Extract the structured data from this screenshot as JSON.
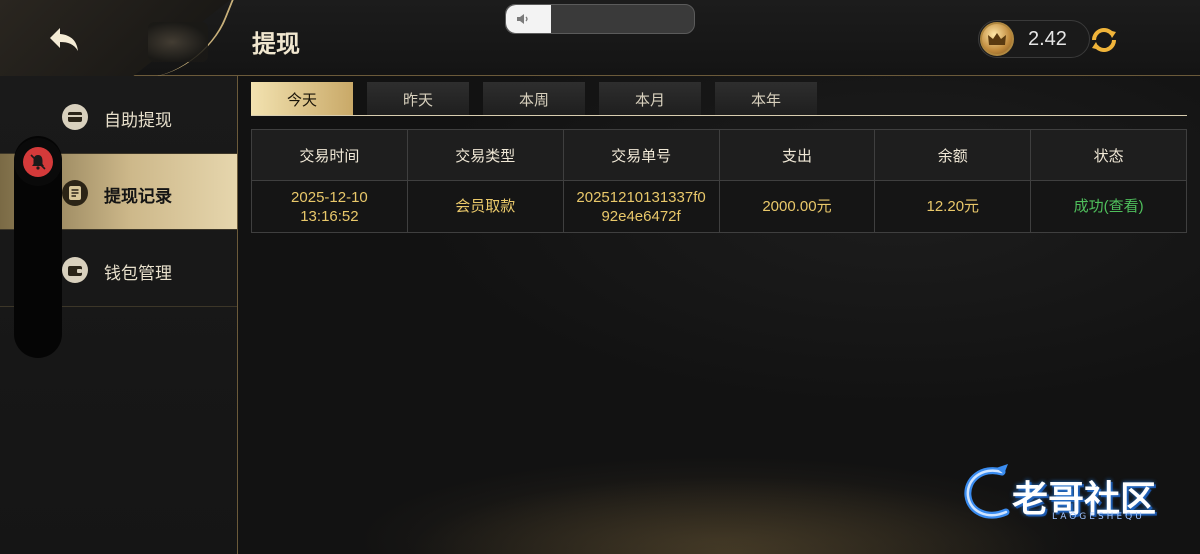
{
  "header": {
    "title": "提现",
    "volume_level": 0.24,
    "balance": "2.42"
  },
  "sidebar": {
    "items": [
      {
        "label": "自助提现",
        "icon": "card-icon",
        "active": false
      },
      {
        "label": "提现记录",
        "icon": "record-icon",
        "active": true
      },
      {
        "label": "钱包管理",
        "icon": "wallet-icon",
        "active": false
      }
    ]
  },
  "tabs": [
    {
      "label": "今天",
      "active": true
    },
    {
      "label": "昨天",
      "active": false
    },
    {
      "label": "本周",
      "active": false
    },
    {
      "label": "本月",
      "active": false
    },
    {
      "label": "本年",
      "active": false
    }
  ],
  "table": {
    "headers": [
      "交易时间",
      "交易类型",
      "交易单号",
      "支出",
      "余额",
      "状态"
    ],
    "rows": [
      {
        "time_date": "2025-12-10",
        "time_clock": "13:16:52",
        "type": "会员取款",
        "order_line1": "20251210131337f0",
        "order_line2": "92e4e6472f",
        "amount": "2000.00元",
        "balance": "12.20元",
        "status": "成功(查看)"
      }
    ]
  },
  "watermark": {
    "text": "老哥社区",
    "sub": "LAOGESHEQU"
  },
  "colors": {
    "accent_gold": "#e9c86a",
    "status_success": "#4fbf5c",
    "mute_red": "#d43a3a"
  }
}
